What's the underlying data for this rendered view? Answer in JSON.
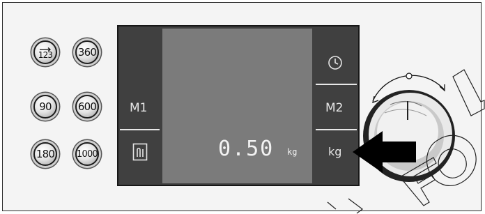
{
  "buttons": [
    {
      "label": "123",
      "icon": "rpm-arrow-icon"
    },
    {
      "label": "360"
    },
    {
      "label": "90"
    },
    {
      "label": "600"
    },
    {
      "label": "180"
    },
    {
      "label": "1000"
    }
  ],
  "panel": {
    "memory_left": "M1",
    "memory_right": "M2",
    "right_unit_label": "kg",
    "clock_icon": "clock-icon",
    "detergent_icon": "detergent-icon"
  },
  "display": {
    "value": "0.50",
    "unit": "kg"
  },
  "watermark": "FOL",
  "colors": {
    "panel": "#404040",
    "screen": "#7b7b7b",
    "arrow": "#000000"
  }
}
